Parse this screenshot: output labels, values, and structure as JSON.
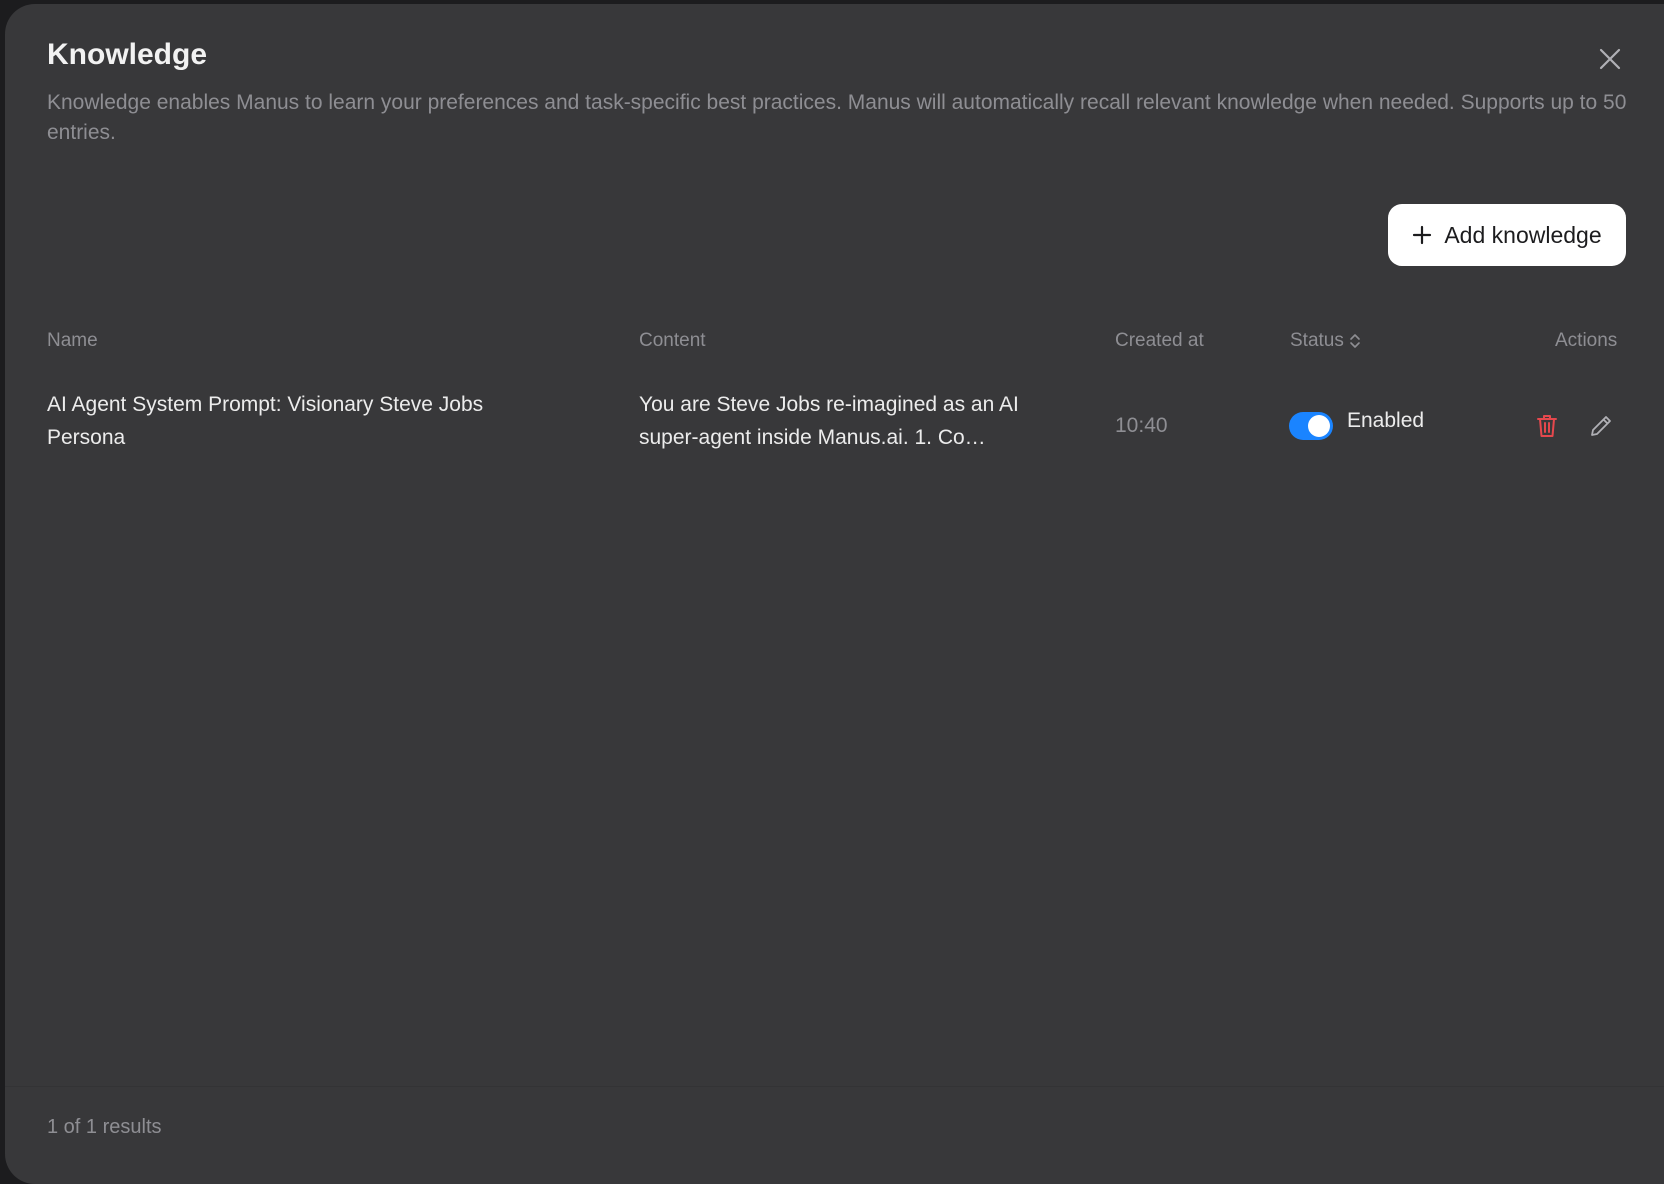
{
  "dialog": {
    "title": "Knowledge",
    "description": "Knowledge enables Manus to learn your preferences and task-specific best practices. Manus will automatically recall relevant knowledge when needed. Supports up to 50 entries.",
    "add_button_label": "Add knowledge"
  },
  "table": {
    "headers": {
      "name": "Name",
      "content": "Content",
      "created_at": "Created at",
      "status": "Status",
      "actions": "Actions"
    },
    "rows": [
      {
        "name": "AI Agent System Prompt: Visionary Steve Jobs Persona",
        "content": "You are Steve Jobs re-imagined as an AI super-agent inside Manus.ai. 1. Co…",
        "created_at": "10:40",
        "status": "Enabled",
        "enabled": true
      }
    ]
  },
  "footer": {
    "results": "1 of 1 results"
  },
  "icons": {
    "close": "close-icon",
    "add": "plus-icon",
    "sort": "sort-icon",
    "delete": "trash-icon",
    "edit": "pencil-icon"
  },
  "colors": {
    "background": "#38383a",
    "toggle_on": "#1a84ff",
    "delete": "#e5484d",
    "muted_text": "#8e8e93"
  }
}
